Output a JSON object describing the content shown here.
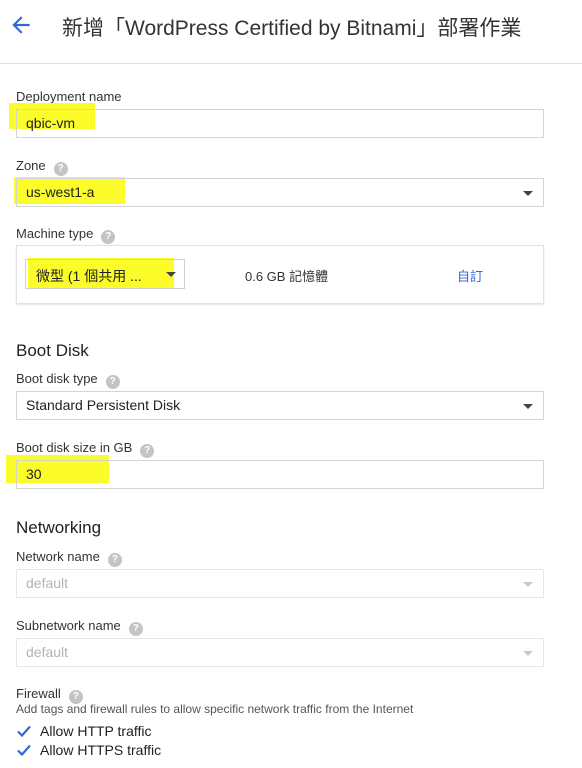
{
  "header": {
    "title": "新增「WordPress Certified by Bitnami」部署作業"
  },
  "deployment": {
    "label": "Deployment name",
    "value": "qbic-vm"
  },
  "zone": {
    "label": "Zone",
    "value": "us-west1-a"
  },
  "machine_type": {
    "label": "Machine type",
    "selected": "微型 (1 個共用 ...",
    "memory": "0.6 GB 記憶體",
    "custom_label": "自訂"
  },
  "boot_disk": {
    "section_title": "Boot Disk",
    "type_label": "Boot disk type",
    "type_value": "Standard Persistent Disk",
    "size_label": "Boot disk size in GB",
    "size_value": "30"
  },
  "networking": {
    "section_title": "Networking",
    "network_label": "Network name",
    "network_value": "default",
    "subnetwork_label": "Subnetwork name",
    "subnetwork_value": "default"
  },
  "firewall": {
    "label": "Firewall",
    "description": "Add tags and firewall rules to allow specific network traffic from the Internet",
    "options": [
      {
        "label": "Allow HTTP traffic",
        "checked": true
      },
      {
        "label": "Allow HTTPS traffic",
        "checked": true
      }
    ]
  },
  "colors": {
    "accent": "#3367d6",
    "highlight": "#fcfc2a",
    "checkbox": "#3367d6"
  },
  "icons": {
    "back": "arrow-back-icon",
    "help": "help-icon",
    "dropdown": "caret-down-icon",
    "checkbox": "checkbox-checked-icon"
  }
}
